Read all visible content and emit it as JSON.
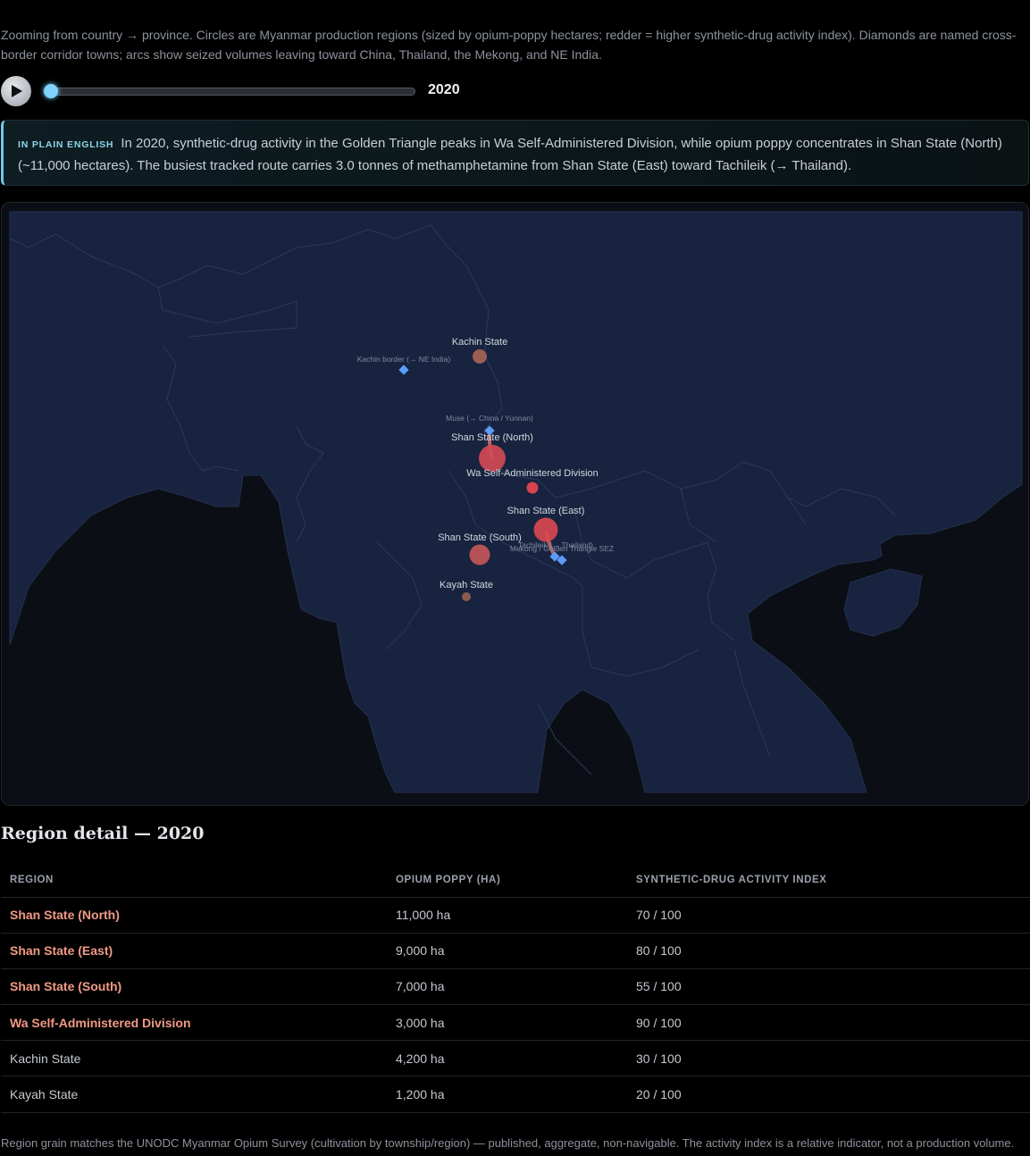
{
  "intro": "Zooming from country → province. Circles are Myanmar production regions (sized by opium-poppy hectares; redder = higher synthetic-drug activity index). Diamonds are named cross-border corridor towns; arcs show seized volumes leaving toward China, Thailand, the Mekong, and NE India.",
  "player": {
    "year": "2020"
  },
  "plain_english": {
    "tag": "IN PLAIN ENGLISH",
    "text": "In 2020, synthetic-drug activity in the Golden Triangle peaks in Wa Self-Administered Division, while opium poppy concentrates in Shan State (North) (~11,000 hectares). The busiest tracked route carries 3.0 tonnes of methamphetamine from Shan State (East) toward Tachileik (→ Thailand)."
  },
  "map": {
    "regions": [
      {
        "name": "Kachin State",
        "hectares": 4200,
        "activity": 30
      },
      {
        "name": "Shan State (North)",
        "hectares": 11000,
        "activity": 70
      },
      {
        "name": "Wa Self-Administered Division",
        "hectares": 3000,
        "activity": 90
      },
      {
        "name": "Shan State (East)",
        "hectares": 9000,
        "activity": 80
      },
      {
        "name": "Shan State (South)",
        "hectares": 7000,
        "activity": 55
      },
      {
        "name": "Kayah State",
        "hectares": 1200,
        "activity": 20
      }
    ],
    "corridors": [
      {
        "name": "Kachin border (→ NE India)"
      },
      {
        "name": "Muse (→ China / Yunnan)"
      },
      {
        "name": "Tachileik (→ Thailand)"
      },
      {
        "name": "Mekong / Golden Triangle SEZ"
      }
    ],
    "colors": {
      "land": "#17233f",
      "sea": "#0b0e14",
      "border": "#2b3a5a",
      "corridor": "#5b9cf5",
      "arc": "#f07a70"
    }
  },
  "detail": {
    "title": "Region detail — 2020",
    "headers": [
      "REGION",
      "OPIUM POPPY (HA)",
      "SYNTHETIC-DRUG ACTIVITY INDEX"
    ],
    "rows": [
      {
        "region": "Shan State (North)",
        "poppy": "11,000 ha",
        "index": "70 / 100",
        "highlight": true
      },
      {
        "region": "Shan State (East)",
        "poppy": "9,000 ha",
        "index": "80 / 100",
        "highlight": true
      },
      {
        "region": "Shan State (South)",
        "poppy": "7,000 ha",
        "index": "55 / 100",
        "highlight": true
      },
      {
        "region": "Wa Self-Administered Division",
        "poppy": "3,000 ha",
        "index": "90 / 100",
        "highlight": true
      },
      {
        "region": "Kachin State",
        "poppy": "4,200 ha",
        "index": "30 / 100",
        "highlight": false
      },
      {
        "region": "Kayah State",
        "poppy": "1,200 ha",
        "index": "20 / 100",
        "highlight": false
      }
    ]
  },
  "footnote": "Region grain matches the UNODC Myanmar Opium Survey (cultivation by township/region) — published, aggregate, non-navigable. The activity index is a relative indicator, not a production volume."
}
